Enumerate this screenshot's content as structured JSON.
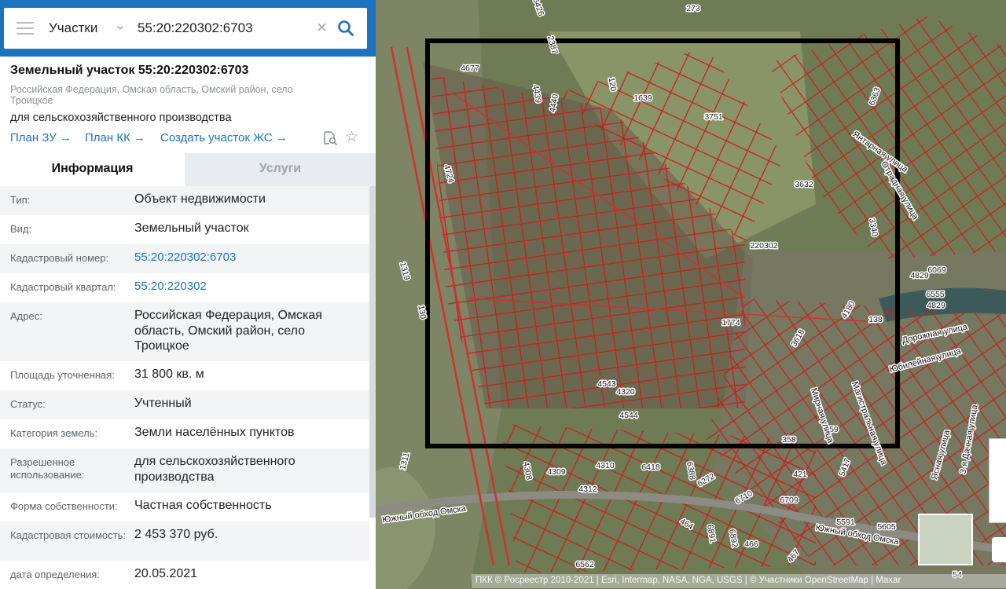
{
  "search": {
    "type_label": "Участки",
    "value": "55:20:220302:6703"
  },
  "parcel": {
    "title": "Земельный участок 55:20:220302:6703",
    "address_short": "Российская Федерация, Омская область, Омский район, село Троицкое",
    "purpose": "для сельскохозяйственного производства",
    "links": {
      "plan_zu": "План ЗУ",
      "plan_kk": "План КК",
      "create_zs": "Создать участок ЖС"
    }
  },
  "tabs": {
    "info": "Информация",
    "services": "Услуги"
  },
  "info_rows": [
    {
      "label": "Тип:",
      "value": "Объект недвижимости"
    },
    {
      "label": "Вид:",
      "value": "Земельный участок"
    },
    {
      "label": "Кадастровый номер:",
      "value": "55:20:220302:6703"
    },
    {
      "label": "Кадастровый квартал:",
      "value": "55:20:220302"
    },
    {
      "label": "Адрес:",
      "value": "Российская Федерация, Омская область, Омский район, село Троицкое"
    },
    {
      "label": "Площадь уточненная:",
      "value": "31 800 кв. м"
    },
    {
      "label": "Статус:",
      "value": "Учтенный"
    },
    {
      "label": "Категория земель:",
      "value": "Земли населённых пунктов"
    },
    {
      "label": "Разрешенное использование:",
      "value": "для сельскохозяйственного производства"
    },
    {
      "label": "Форма собственности:",
      "value": "Частная собственность"
    },
    {
      "label": "Кадастровая стоимость:",
      "value": "2 453 370 руб."
    },
    {
      "label": "дата определения:",
      "value": "20.05.2021"
    }
  ],
  "map": {
    "plot_labels": [
      "273",
      "6426",
      "4677",
      "2387",
      "4439",
      "4440",
      "120",
      "1639",
      "3751",
      "6363",
      "4724",
      "3632",
      "220302",
      "3340",
      "1319",
      "1774",
      "4180",
      "138",
      "4829",
      "6069",
      "6555",
      "4829",
      "130",
      "3618",
      "4543",
      "4320",
      "4544",
      "359",
      "1311",
      "4308",
      "4309",
      "4310",
      "6418",
      "6388",
      "6272",
      "421",
      "5417",
      "4312",
      "6710",
      "6709",
      "5591",
      "5605",
      "464",
      "6891",
      "6892",
      "466",
      "467",
      "6562",
      "54",
      "358"
    ],
    "street_labels": [
      "Янтарная улица",
      "Отрадная улица",
      "Дорожная улица",
      "Юбилейная улица",
      "Мирная улица",
      "Магистральная улица",
      "Ясная улица",
      "3-я Дачная улица",
      "Южный обход Омска",
      "Южный обход Омска"
    ],
    "attribution": "ПКК © Росреестр 2010-2021 | Esri, Intermap, NASA, NGA, USGS | © Участники OpenStreetMap | Maxar"
  }
}
